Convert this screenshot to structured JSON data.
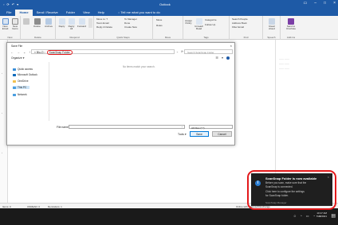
{
  "outlook": {
    "window_title": "Outlook",
    "tabs": [
      "File",
      "Home",
      "Send / Receive",
      "Folder",
      "View",
      "Help"
    ],
    "active_tab": "Home",
    "tell_me": "Tell me what you want to do",
    "groups": [
      "New",
      "Delete",
      "Respond",
      "Quick Steps",
      "Move",
      "Tags",
      "Find",
      "Speech",
      "Add-ins"
    ],
    "buttons": {
      "new_email": "New Email",
      "new_items": "New Items",
      "delete": "Delete",
      "archive": "Archive",
      "reply": "Reply",
      "reply_all": "Reply All",
      "forward": "Forward",
      "move_to": "Move to: ?",
      "to_manager": "To Manager",
      "team_email": "Team Email",
      "done": "Done",
      "reply_delete": "Reply & Delete",
      "create_new": "Create New",
      "move": "Move",
      "rules": "Rules",
      "assign_policy": "Assign Policy",
      "unread_read": "Unread/ Read",
      "categorize": "Categorize",
      "follow_up": "Follow Up",
      "search_people": "Search People",
      "address_book": "Address Book",
      "filter_email": "Filter Email",
      "read_aloud": "Read Aloud",
      "send_to_onenote": "Send to OneNote"
    },
    "status_left": "Items: 0",
    "status_unread": "UNREAD: 0",
    "status_reminders": "Reminders: 1",
    "status_right": "Online with: Microsoft Exchange"
  },
  "dialog": {
    "title": "Save File",
    "breadcrumb_prefix": "« Blu-O",
    "breadcrumb_current": "ScanSnap Folder",
    "search_placeholder": "Search ScanSnap Folder",
    "organize": "Organize ▾",
    "new_folder": "New folder",
    "empty_message": "No items match your search.",
    "nav_items": [
      "Quick access",
      "Microsoft Outlook",
      "OneDrive",
      "This PC",
      "Network"
    ],
    "nav_selected": "This PC",
    "file_name_label": "File name:",
    "file_name_value": "",
    "filter_value": "All Files (*.*)",
    "tools": "Tools ▾",
    "save": "Save",
    "cancel": "Cancel"
  },
  "toast": {
    "title": "ScanSnap Folder is now available",
    "lines": [
      "Before you scan, make sure that the",
      "ScanSnap is connected.",
      "Click here to configure the settings",
      "for ScanSnap folder."
    ],
    "source": "ScanSnap Manager"
  },
  "taskbar": {
    "time": "10:17 AM",
    "date": "7/29/2021"
  },
  "colors": {
    "accent": "#1e5aa6",
    "highlight": "#e3191b",
    "selection": "#cce4f7"
  }
}
